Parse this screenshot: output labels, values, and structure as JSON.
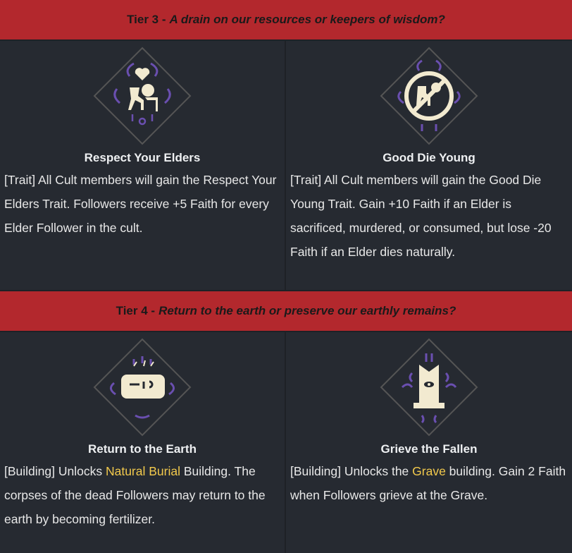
{
  "tiers": [
    {
      "label": "Tier 3 -",
      "question": "A drain on our resources or keepers of wisdom?",
      "options": [
        {
          "title": "Respect Your Elders",
          "icon": "elder-heart-icon",
          "desc": "[Trait] All Cult members will gain the Respect Your Elders Trait. Followers receive +5 Faith for every Elder Follower in the cult."
        },
        {
          "title": "Good Die Young",
          "icon": "no-elder-icon",
          "desc": "[Trait] All Cult members will gain the Good Die Young Trait. Gain +10 Faith if an Elder is sacrificed, murdered, or consumed, but lose -20 Faith if an Elder dies naturally."
        }
      ]
    },
    {
      "label": "Tier 4 -",
      "question": "Return to the earth or preserve our earthly remains?",
      "options": [
        {
          "title": "Return to the Earth",
          "icon": "natural-burial-icon",
          "desc_pre": "[Building] Unlocks ",
          "link": "Natural Burial",
          "desc_post": " Building. The corpses of the dead Followers may return to the earth by becoming fertilizer."
        },
        {
          "title": "Grieve the Fallen",
          "icon": "grave-icon",
          "desc_pre": "[Building] Unlocks the ",
          "link": "Grave",
          "desc_post": " building. Gain 2 Faith when Followers grieve at the Grave."
        }
      ]
    }
  ],
  "colors": {
    "header": "#b3282d",
    "background": "#262a31",
    "link": "#f2c94c",
    "accent": "#6a4fb0",
    "icon_fill": "#f2ead0"
  }
}
